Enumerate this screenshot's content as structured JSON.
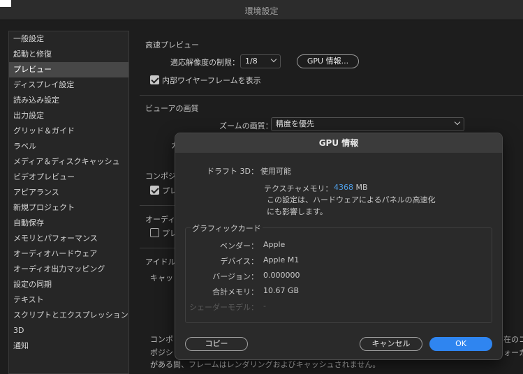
{
  "window": {
    "title": "環境設定"
  },
  "sidebar": {
    "items": [
      {
        "label": "一般設定"
      },
      {
        "label": "起動と修復"
      },
      {
        "label": "プレビュー",
        "selected": true
      },
      {
        "label": "ディスプレイ設定"
      },
      {
        "label": "読み込み設定"
      },
      {
        "label": "出力設定"
      },
      {
        "label": "グリッド＆ガイド"
      },
      {
        "label": "ラベル"
      },
      {
        "label": "メディア＆ディスクキャッシュ"
      },
      {
        "label": "ビデオプレビュー"
      },
      {
        "label": "アピアランス"
      },
      {
        "label": "新規プロジェクト"
      },
      {
        "label": "自動保存"
      },
      {
        "label": "メモリとパフォーマンス"
      },
      {
        "label": "オーディオハードウェア"
      },
      {
        "label": "オーディオ出力マッピング"
      },
      {
        "label": "設定の同期"
      },
      {
        "label": "テキスト"
      },
      {
        "label": "スクリプトとエクスプレッション"
      },
      {
        "label": "3D"
      },
      {
        "label": "通知"
      }
    ]
  },
  "fast_preview": {
    "title": "高速プレビュー",
    "resolution_label": "適応解像度の制限：",
    "resolution_value": "1/8",
    "gpu_button": "GPU 情報...",
    "wireframe_label": "内部ワイヤーフレームを表示",
    "wireframe_checked": true
  },
  "viewer_quality": {
    "title": "ビューアの画質",
    "zoom_label": "ズームの画質：",
    "zoom_value": "精度を優先",
    "partial_label": "カ"
  },
  "background_fragments": {
    "composition": "コンポジ",
    "comp_check_label": "プレ",
    "audio": "オーディ",
    "audio_check_label": "プレ",
    "idle": "アイドル",
    "cache": "キャッ",
    "bottom_line1_left": "コンポ",
    "bottom_line1_right": "在のコ",
    "bottom_line2_left": "ポジシ",
    "bottom_line2_right": "ォーカ",
    "bottom_line3": "がある間、フレームはレンダリングおよびキャッシュされません。"
  },
  "gpu_dialog": {
    "title": "GPU 情報",
    "draft3d_label": "ドラフト 3D：",
    "draft3d_value": "使用可能",
    "texture_label": "テクスチャメモリ：",
    "texture_value": "4368",
    "texture_unit": "MB",
    "note_line1": "この設定は、ハードウェアによるパネルの高速化",
    "note_line2": "にも影響します。",
    "card_group_title": "グラフィックカード",
    "vendor_label": "ベンダー：",
    "vendor_value": "Apple",
    "device_label": "デバイス：",
    "device_value": "Apple M1",
    "version_label": "バージョン：",
    "version_value": "0.000000",
    "memory_label": "合計メモリ：",
    "memory_value": "10.67 GB",
    "shader_label": "シェーダーモデル：",
    "shader_value": "-",
    "copy_button": "コピー",
    "cancel_button": "キャンセル",
    "ok_button": "OK"
  },
  "colors": {
    "accent": "#2f85f0",
    "link_value": "#4f9fe8",
    "selected_bg": "#474747"
  }
}
